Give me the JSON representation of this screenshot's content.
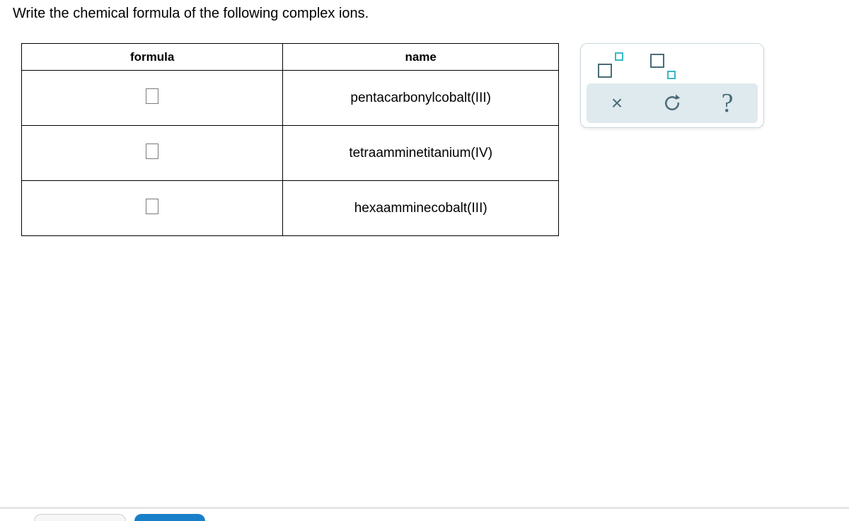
{
  "prompt": "Write the chemical formula of the following complex ions.",
  "table": {
    "headers": {
      "formula": "formula",
      "name": "name"
    },
    "rows": [
      {
        "formula": "",
        "name": "pentacarbonylcobalt(III)"
      },
      {
        "formula": "",
        "name": "tetraamminetitanium(IV)"
      },
      {
        "formula": "",
        "name": "hexaamminecobalt(III)"
      }
    ]
  },
  "controls": {
    "superscript_tool": "superscript",
    "subscript_tool": "subscript",
    "clear": "×",
    "reset": "reset",
    "help": "?"
  }
}
